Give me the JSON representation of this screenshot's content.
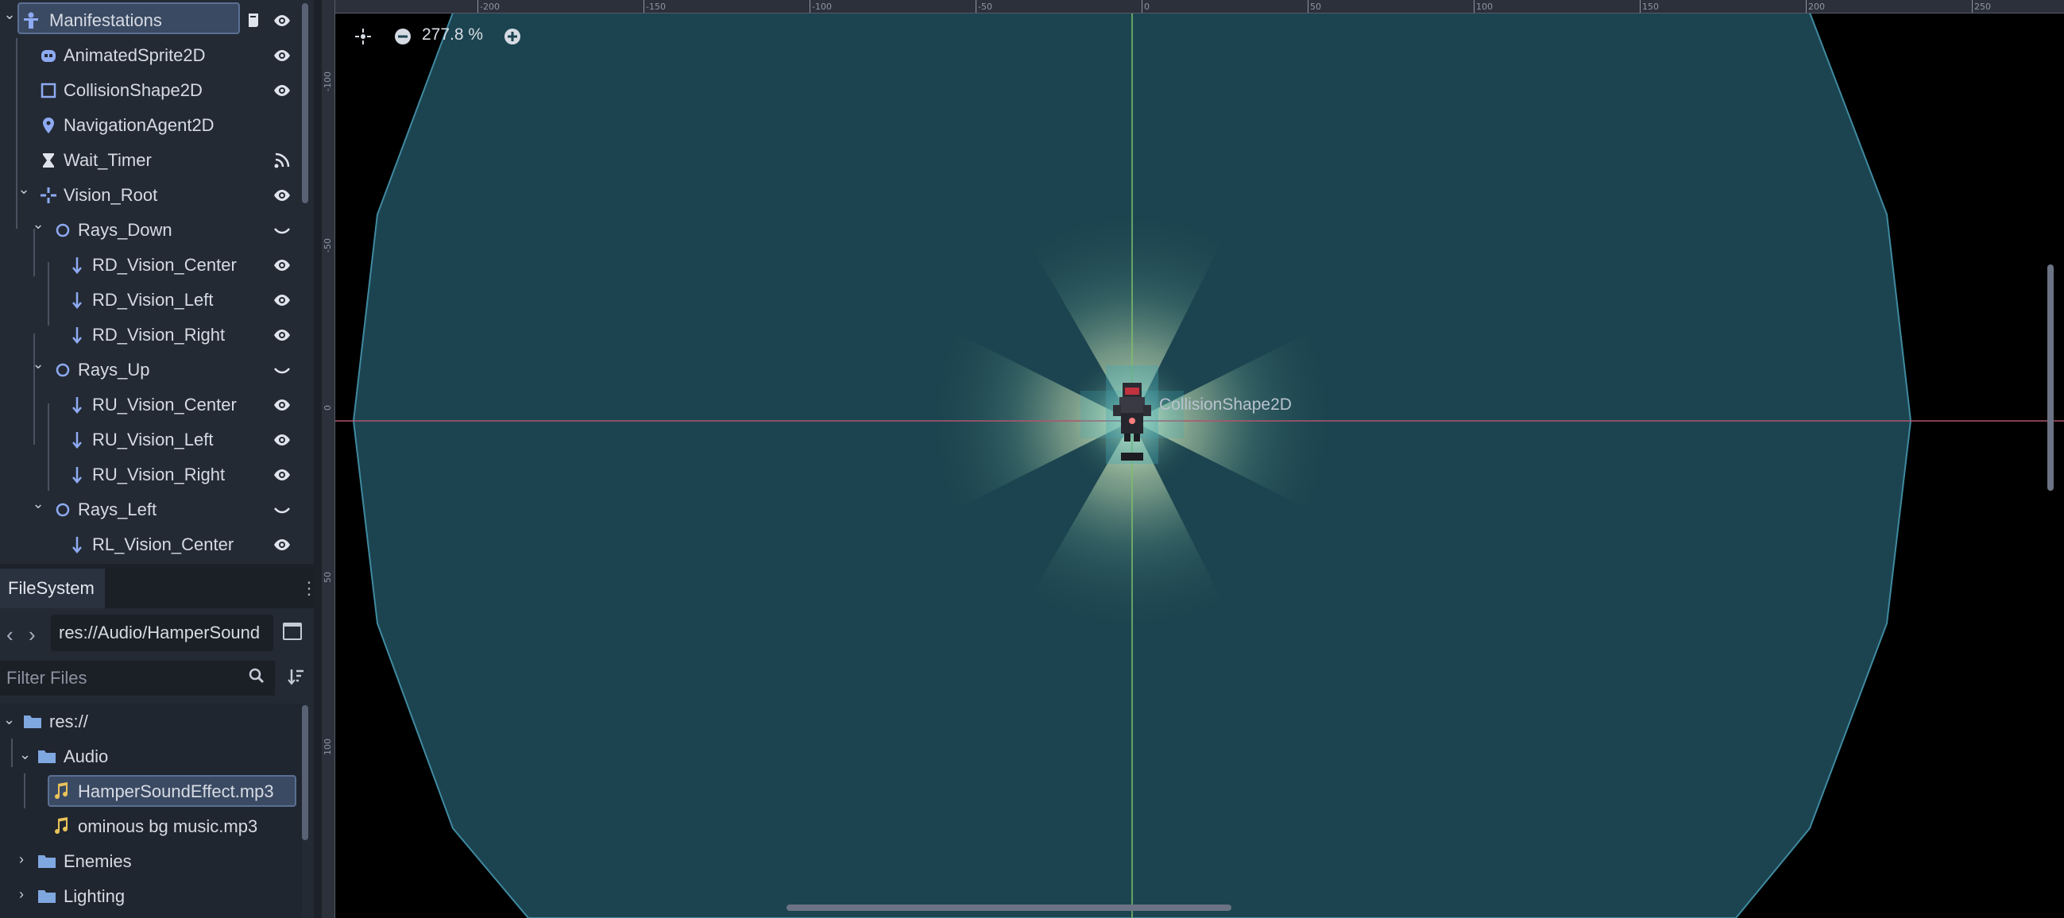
{
  "scene_tree": {
    "root": {
      "label": "Manifestations",
      "icon": "character-body-icon"
    },
    "nodes": [
      {
        "label": "AnimatedSprite2D",
        "icon": "animated-sprite-icon",
        "status": "visible"
      },
      {
        "label": "CollisionShape2D",
        "icon": "collision-shape-icon",
        "status": "visible"
      },
      {
        "label": "NavigationAgent2D",
        "icon": "navigation-pin-icon",
        "status": "none"
      },
      {
        "label": "Wait_Timer",
        "icon": "hourglass-icon",
        "status": "signal"
      },
      {
        "label": "Vision_Root",
        "icon": "node2d-cross-icon",
        "status": "visible"
      },
      {
        "label": "Rays_Down",
        "icon": "circle-node-icon",
        "status": "hidden"
      },
      {
        "label": "RD_Vision_Center",
        "icon": "raycast-arrow-icon",
        "status": "visible"
      },
      {
        "label": "RD_Vision_Left",
        "icon": "raycast-arrow-icon",
        "status": "visible"
      },
      {
        "label": "RD_Vision_Right",
        "icon": "raycast-arrow-icon",
        "status": "visible"
      },
      {
        "label": "Rays_Up",
        "icon": "circle-node-icon",
        "status": "hidden"
      },
      {
        "label": "RU_Vision_Center",
        "icon": "raycast-arrow-icon",
        "status": "visible"
      },
      {
        "label": "RU_Vision_Left",
        "icon": "raycast-arrow-icon",
        "status": "visible"
      },
      {
        "label": "RU_Vision_Right",
        "icon": "raycast-arrow-icon",
        "status": "visible"
      },
      {
        "label": "Rays_Left",
        "icon": "circle-node-icon",
        "status": "hidden"
      },
      {
        "label": "RL_Vision_Center",
        "icon": "raycast-arrow-icon",
        "status": "visible"
      }
    ]
  },
  "filesystem": {
    "tab_label": "FileSystem",
    "path": "res://Audio/HamperSound",
    "filter_placeholder": "Filter Files",
    "tree": [
      {
        "label": "res://",
        "type": "folder"
      },
      {
        "label": "Audio",
        "type": "folder"
      },
      {
        "label": "HamperSoundEffect.mp3",
        "type": "audio",
        "selected": true
      },
      {
        "label": "ominous bg music.mp3",
        "type": "audio"
      },
      {
        "label": "Enemies",
        "type": "folder"
      },
      {
        "label": "Lighting",
        "type": "folder"
      }
    ]
  },
  "viewport": {
    "zoom_label": "277.8 %",
    "selected_shape_label": "CollisionShape2D",
    "ruler_top": [
      "-200",
      "-150",
      "-100",
      "-50",
      "0",
      "50",
      "100",
      "150",
      "200",
      "250"
    ],
    "ruler_left": [
      "-100",
      "-50",
      "0",
      "50",
      "100"
    ],
    "colors": {
      "vision_polygon": "#1c4450",
      "vision_edge": "#3f8aa0",
      "background": "#000000",
      "x_axis": "#b0556d",
      "y_axis": "#7fbf6a",
      "light_glow": "#e8f5c8"
    }
  }
}
